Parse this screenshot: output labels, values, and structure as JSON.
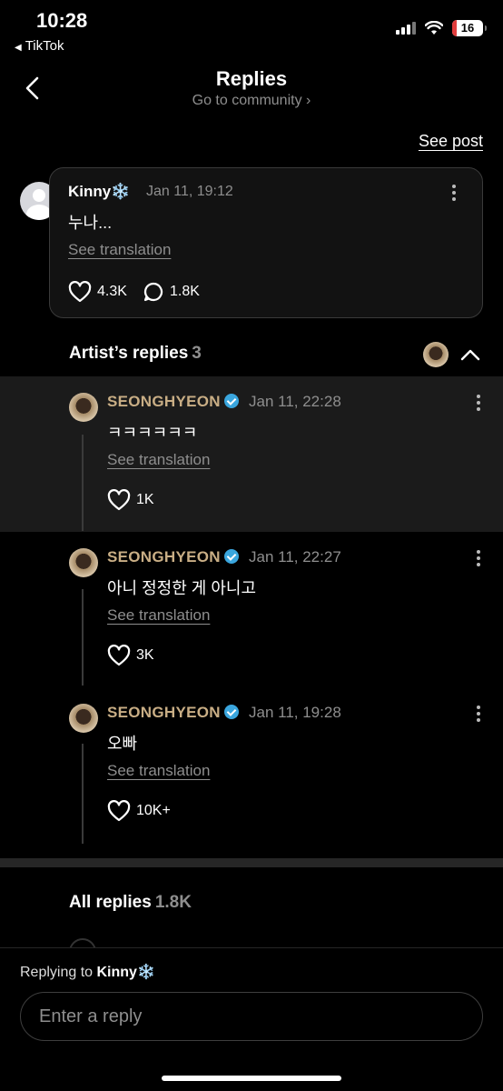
{
  "status_bar": {
    "time": "10:28",
    "back_app": "TikTok",
    "battery": "16"
  },
  "header": {
    "title": "Replies",
    "subtitle": "Go to community ›"
  },
  "see_post": "See post",
  "main_comment": {
    "author": "Kinny❄️",
    "date": "Jan 11, 19:12",
    "text": "누나...",
    "translate": "See translation",
    "likes": "4.3K",
    "comments": "1.8K"
  },
  "artist_replies": {
    "title": "Artist’s replies",
    "count": "3",
    "items": [
      {
        "author": "SEONGHYEON",
        "date": "Jan 11, 22:28",
        "text": "ㅋㅋㅋㅋㅋㅋ",
        "translate": "See translation",
        "likes": "1K"
      },
      {
        "author": "SEONGHYEON",
        "date": "Jan 11, 22:27",
        "text": "아니 정정한 게 아니고",
        "translate": "See translation",
        "likes": "3K"
      },
      {
        "author": "SEONGHYEON",
        "date": "Jan 11, 19:28",
        "text": "오빠",
        "translate": "See translation",
        "likes": "10K+"
      }
    ]
  },
  "all_replies": {
    "title": "All replies",
    "count": "1.8K"
  },
  "composer": {
    "replying_prefix": "Replying to",
    "replying_to": "Kinny❄️",
    "placeholder": "Enter a reply"
  },
  "colors": {
    "artist_name": "#c9ae85",
    "verified": "#3aa6de",
    "background": "#000000"
  }
}
